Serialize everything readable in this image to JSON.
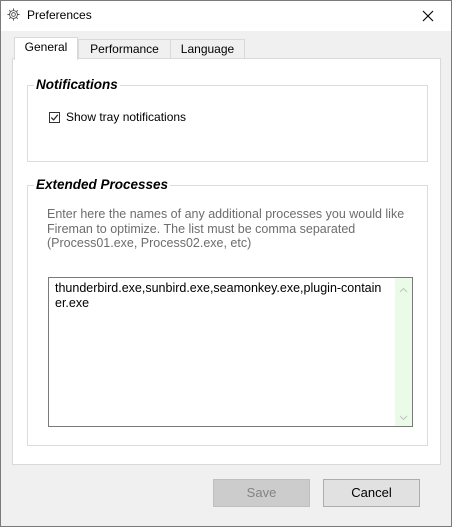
{
  "window": {
    "title": "Preferences",
    "close_icon": "close-icon",
    "app_icon": "gear-icon"
  },
  "tabs": [
    {
      "label": "General",
      "active": true
    },
    {
      "label": "Performance",
      "active": false
    },
    {
      "label": "Language",
      "active": false
    }
  ],
  "notifications": {
    "heading": "Notifications",
    "show_tray_label": "Show tray notifications",
    "show_tray_checked": true
  },
  "extended_processes": {
    "heading": "Extended Processes",
    "description": "Enter here the names of any additional processes you would like Fireman to optimize. The list must be comma separated (Process01.exe, Process02.exe, etc)",
    "value": "thunderbird.exe,sunbird.exe,seamonkey.exe,plugin-container.exe"
  },
  "buttons": {
    "save_label": "Save",
    "save_enabled": false,
    "cancel_label": "Cancel"
  },
  "colors": {
    "scrollbar_track": "#eafbe7",
    "disabled_button": "#cccccc",
    "description_text": "#6d6d6d"
  }
}
